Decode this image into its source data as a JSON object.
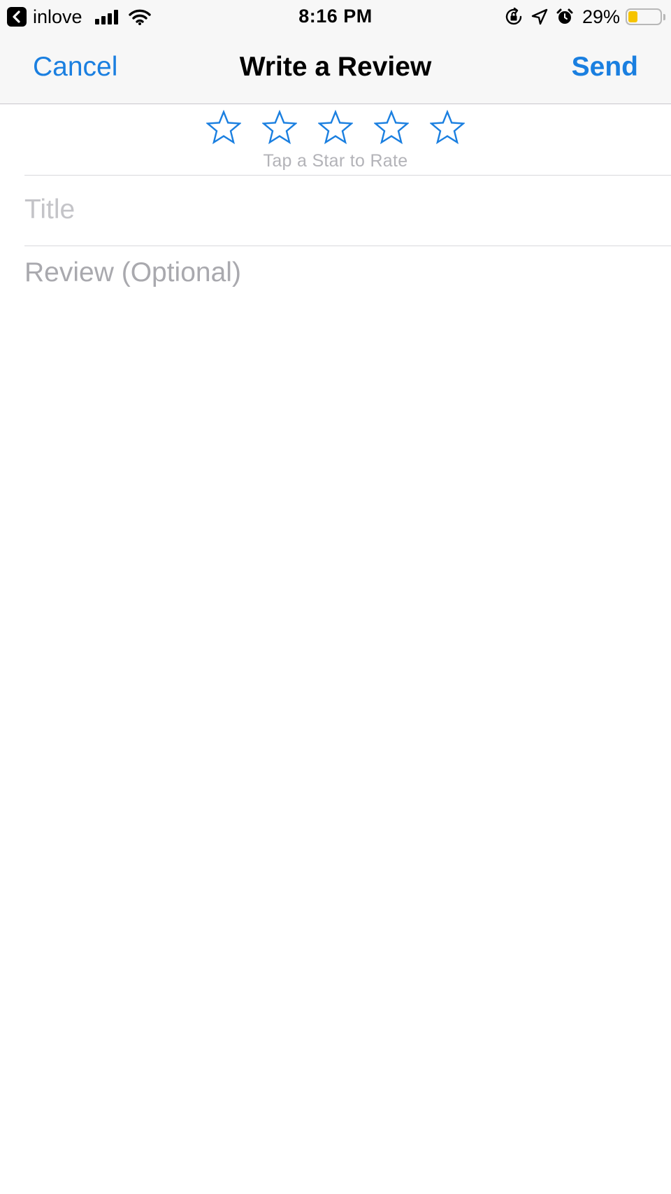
{
  "status_bar": {
    "back_app_label": "inlove",
    "time": "8:16 PM",
    "battery_percent": "29%",
    "battery_level": 0.29,
    "battery_color": "#f6c400",
    "icons": [
      "back-app-icon",
      "signal-icon",
      "wifi-icon",
      "orientation-lock-icon",
      "location-icon",
      "alarm-icon",
      "battery-icon"
    ]
  },
  "nav": {
    "cancel_label": "Cancel",
    "title": "Write a Review",
    "send_label": "Send",
    "accent_color": "#1a7fe0"
  },
  "rating": {
    "max_stars": 5,
    "current": 0,
    "hint": "Tap a Star to Rate",
    "star_icon": "star-outline-icon"
  },
  "form": {
    "title_placeholder": "Title",
    "title_value": "",
    "review_placeholder": "Review (Optional)",
    "review_value": ""
  }
}
